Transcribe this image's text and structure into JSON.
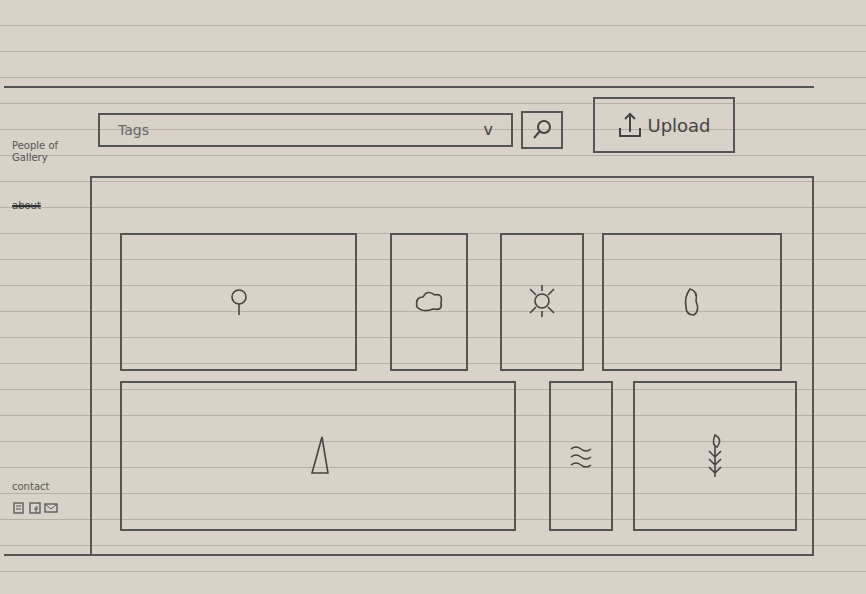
{
  "sidebar": {
    "title": "People of Gallery",
    "items": [
      {
        "label": "about",
        "crossed_out": true
      }
    ],
    "contact": {
      "label": "contact"
    }
  },
  "search": {
    "value": "Tags",
    "dropdown": "v"
  },
  "upload": {
    "label": "Upload"
  },
  "gallery": {
    "rows": [
      [
        {
          "kind": "tree"
        },
        {
          "kind": "cloud"
        },
        {
          "kind": "sun"
        },
        {
          "kind": "bush"
        }
      ],
      [
        {
          "kind": "mountain"
        },
        {
          "kind": "water"
        },
        {
          "kind": "plant"
        }
      ]
    ]
  }
}
